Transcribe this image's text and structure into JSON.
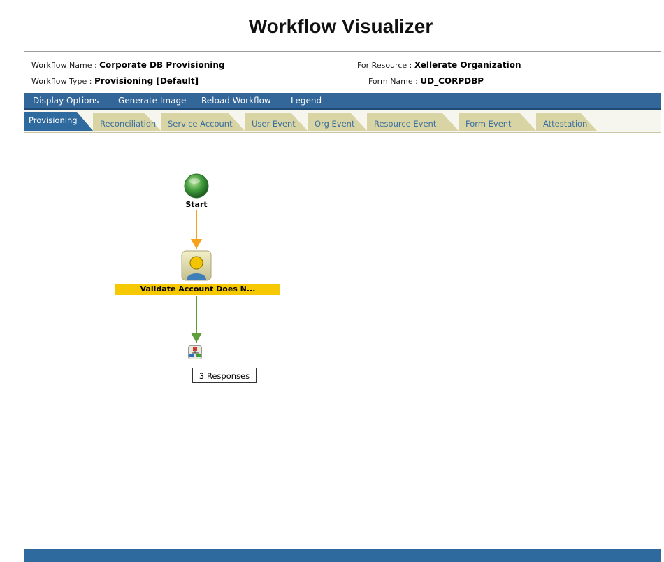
{
  "page": {
    "title": "Workflow Visualizer"
  },
  "info": {
    "workflow_name_label": "Workflow Name :",
    "workflow_name_value": "Corporate DB Provisioning",
    "workflow_type_label": "Workflow Type :",
    "workflow_type_value": "Provisioning [Default]",
    "for_resource_label": "For Resource :",
    "for_resource_value": "Xellerate Organization",
    "form_name_label": "Form Name :",
    "form_name_value": "UD_CORPDBP"
  },
  "menu": {
    "display_options": "Display Options",
    "generate_image": "Generate Image",
    "reload_workflow": "Reload Workflow",
    "legend": "Legend"
  },
  "tabs": {
    "provisioning": "Provisioning",
    "reconciliation": "Reconciliation",
    "service_account": "Service Account",
    "user_event": "User Event",
    "org_event": "Org Event",
    "resource_event": "Resource Event",
    "form_event": "Form Event",
    "attestation": "Attestation"
  },
  "workflow": {
    "start_label": "Start",
    "task_label": "Validate Account Does N...",
    "responses_label": "3 Responses",
    "colors": {
      "start_node": "#3f9b3a",
      "arrow_start": "#f7a21b",
      "arrow_response": "#5f9e3a",
      "task_highlight": "#f5c800"
    }
  }
}
